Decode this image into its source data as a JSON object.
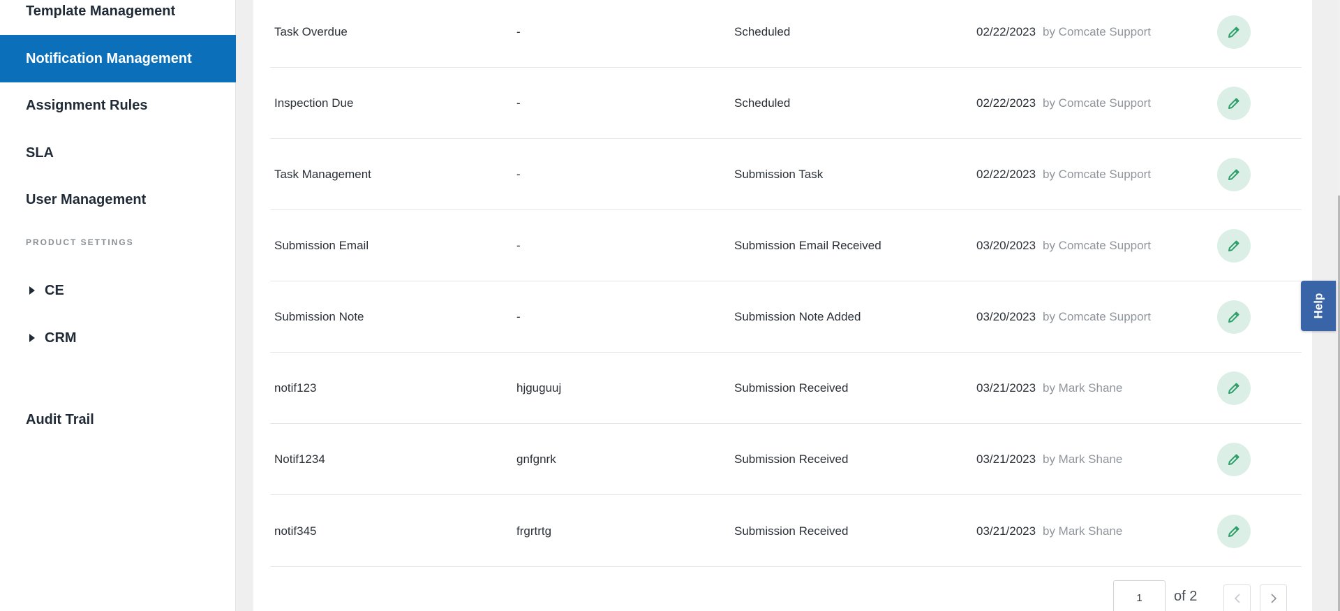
{
  "sidebar": {
    "items_top": [
      {
        "label": "Template Management"
      },
      {
        "label": "Notification Management"
      },
      {
        "label": "Assignment Rules"
      },
      {
        "label": "SLA"
      },
      {
        "label": "User Management"
      }
    ],
    "section_label": "PRODUCT SETTINGS",
    "groups": [
      {
        "label": "CE",
        "icon": "caret-right-icon"
      },
      {
        "label": "CRM",
        "icon": "caret-right-icon"
      }
    ],
    "bottom_item": "Audit Trail"
  },
  "table": {
    "rows": [
      {
        "name": "Task Overdue",
        "description": "-",
        "trigger": "Scheduled",
        "date": "02/22/2023",
        "by": "by Comcate Support"
      },
      {
        "name": "Inspection Due",
        "description": "-",
        "trigger": "Scheduled",
        "date": "02/22/2023",
        "by": "by Comcate Support"
      },
      {
        "name": "Task Management",
        "description": "-",
        "trigger": "Submission Task",
        "date": "02/22/2023",
        "by": "by Comcate Support"
      },
      {
        "name": "Submission Email",
        "description": "-",
        "trigger": "Submission Email Received",
        "date": "03/20/2023",
        "by": "by Comcate Support"
      },
      {
        "name": "Submission Note",
        "description": "-",
        "trigger": "Submission Note Added",
        "date": "03/20/2023",
        "by": "by Comcate Support"
      },
      {
        "name": "notif123",
        "description": "hjguguuj",
        "trigger": "Submission Received",
        "date": "03/21/2023",
        "by": "by Mark Shane"
      },
      {
        "name": "Notif1234",
        "description": "gnfgnrk",
        "trigger": "Submission Received",
        "date": "03/21/2023",
        "by": "by Mark Shane"
      },
      {
        "name": "notif345",
        "description": "frgrtrtg",
        "trigger": "Submission Received",
        "date": "03/21/2023",
        "by": "by Mark Shane"
      }
    ]
  },
  "pagination": {
    "current_page": "1",
    "of_label": "of 2"
  },
  "help": {
    "label": "Help"
  },
  "colors": {
    "accent": "#0b6fba",
    "edit_bg": "#dcefe6",
    "edit_icon": "#2e9e6b",
    "help_bg": "#3a64a8"
  }
}
